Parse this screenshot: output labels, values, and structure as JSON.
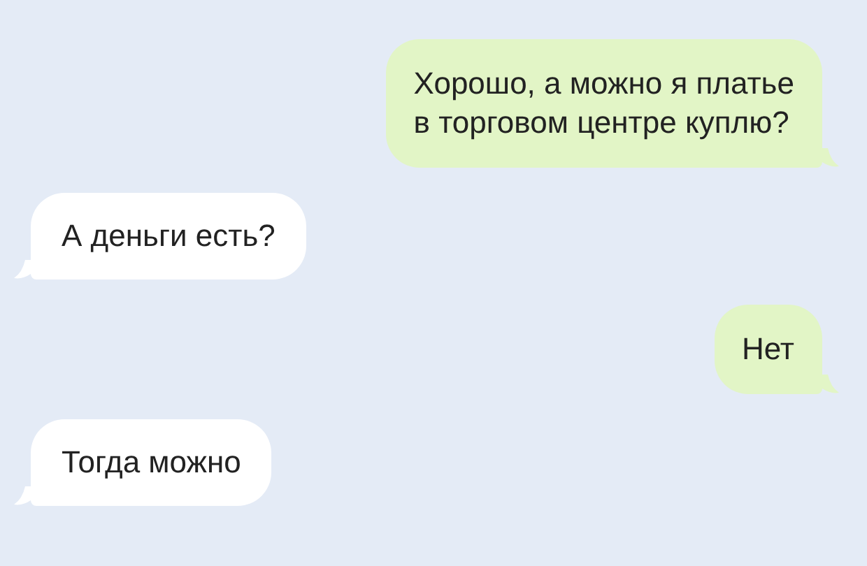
{
  "messages": [
    {
      "kind": "outgoing",
      "text": "Хорошо, а можно я платье\nв торговом центре куплю?"
    },
    {
      "kind": "incoming",
      "text": "А деньги есть?"
    },
    {
      "kind": "outgoing",
      "text": "Нет"
    },
    {
      "kind": "incoming",
      "text": "Тогда можно"
    }
  ]
}
